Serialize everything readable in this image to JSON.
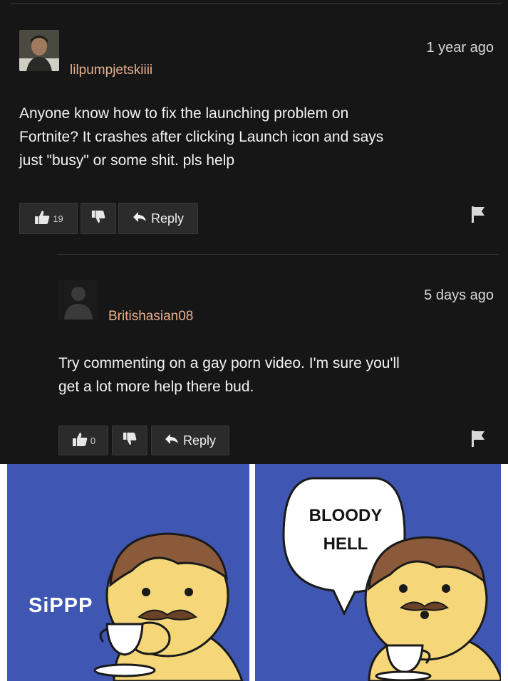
{
  "comments": [
    {
      "username": "lilpumpjetskiiii",
      "time": "1 year ago",
      "text_lines": [
        "Anyone know how to fix the launching problem on",
        "Fortnite? It crashes after clicking Launch icon and says",
        "just \"busy\" or some shit. pls help"
      ],
      "likes": "19",
      "reply_label": "Reply"
    },
    {
      "username": "Britishasian08",
      "time": "5 days ago",
      "text_lines": [
        "Try commenting on a gay porn video. I'm sure you'll",
        "get a lot more help there bud."
      ],
      "likes": "0",
      "reply_label": "Reply"
    }
  ],
  "comic": {
    "left_sfx": "SiPPP",
    "bubble_lines": [
      "BLOODY",
      "HELL"
    ]
  },
  "colors": {
    "background": "#161616",
    "username": "#e9b08e",
    "comic_bg": "#3f56b3"
  }
}
